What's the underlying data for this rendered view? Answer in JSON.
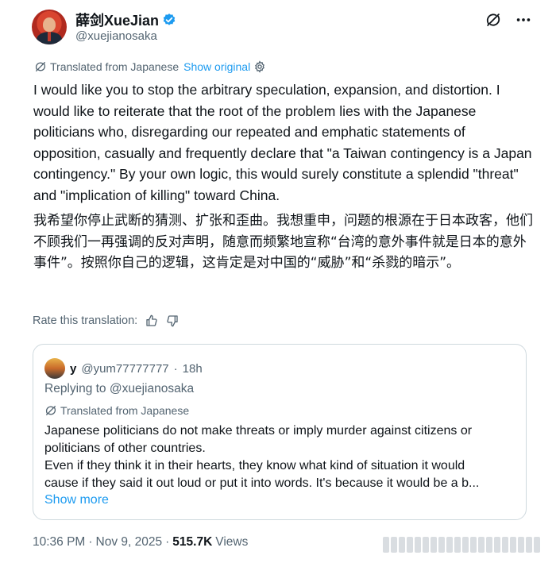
{
  "author": {
    "display_name": "薛剑XueJian",
    "handle": "@xuejianosaka"
  },
  "translation_bar": {
    "label": "Translated from Japanese",
    "show_original": "Show original"
  },
  "tweet": {
    "text_en": "I would like you to stop the arbitrary speculation, expansion, and distortion. I would like to reiterate that the root of the problem lies with the Japanese politicians who, disregarding our repeated and emphatic statements of opposition, casually and frequently declare that \"a Taiwan contingency is a Japan contingency.\" By your own logic, this would surely constitute a splendid \"threat\" and \"implication of killing\" toward China.",
    "text_zh": "我希望你停止武断的猜测、扩张和歪曲。我想重申，问题的根源在于日本政客，他们不顾我们一再强调的反对声明，随意而频繁地宣称“台湾的意外事件就是日本的意外事件”。按照你自己的逻辑，这肯定是对中国的“威胁”和“杀戮的暗示”。"
  },
  "rate": {
    "label": "Rate this translation:"
  },
  "quote": {
    "name": "y",
    "handle": "@yum77777777",
    "separator": "·",
    "time": "18h",
    "replying_to": "Replying to @xuejianosaka",
    "translated_label": "Translated from Japanese",
    "lines": [
      "Japanese politicians do not make threats or imply murder against citizens or",
      "politicians of other countries.",
      "Even if they think it in their hearts, they know what kind of situation it would",
      "cause if they said it out loud or put it into words.    It's because it would be a b..."
    ],
    "show_more": "Show more"
  },
  "meta": {
    "time": "10:36 PM",
    "separator": "·",
    "date": "Nov 9, 2025",
    "views_count": "515.7K",
    "views_label": "Views"
  },
  "colors": {
    "accent": "#1d9bf0",
    "secondary_text": "#536471",
    "border": "#cfd9de"
  }
}
